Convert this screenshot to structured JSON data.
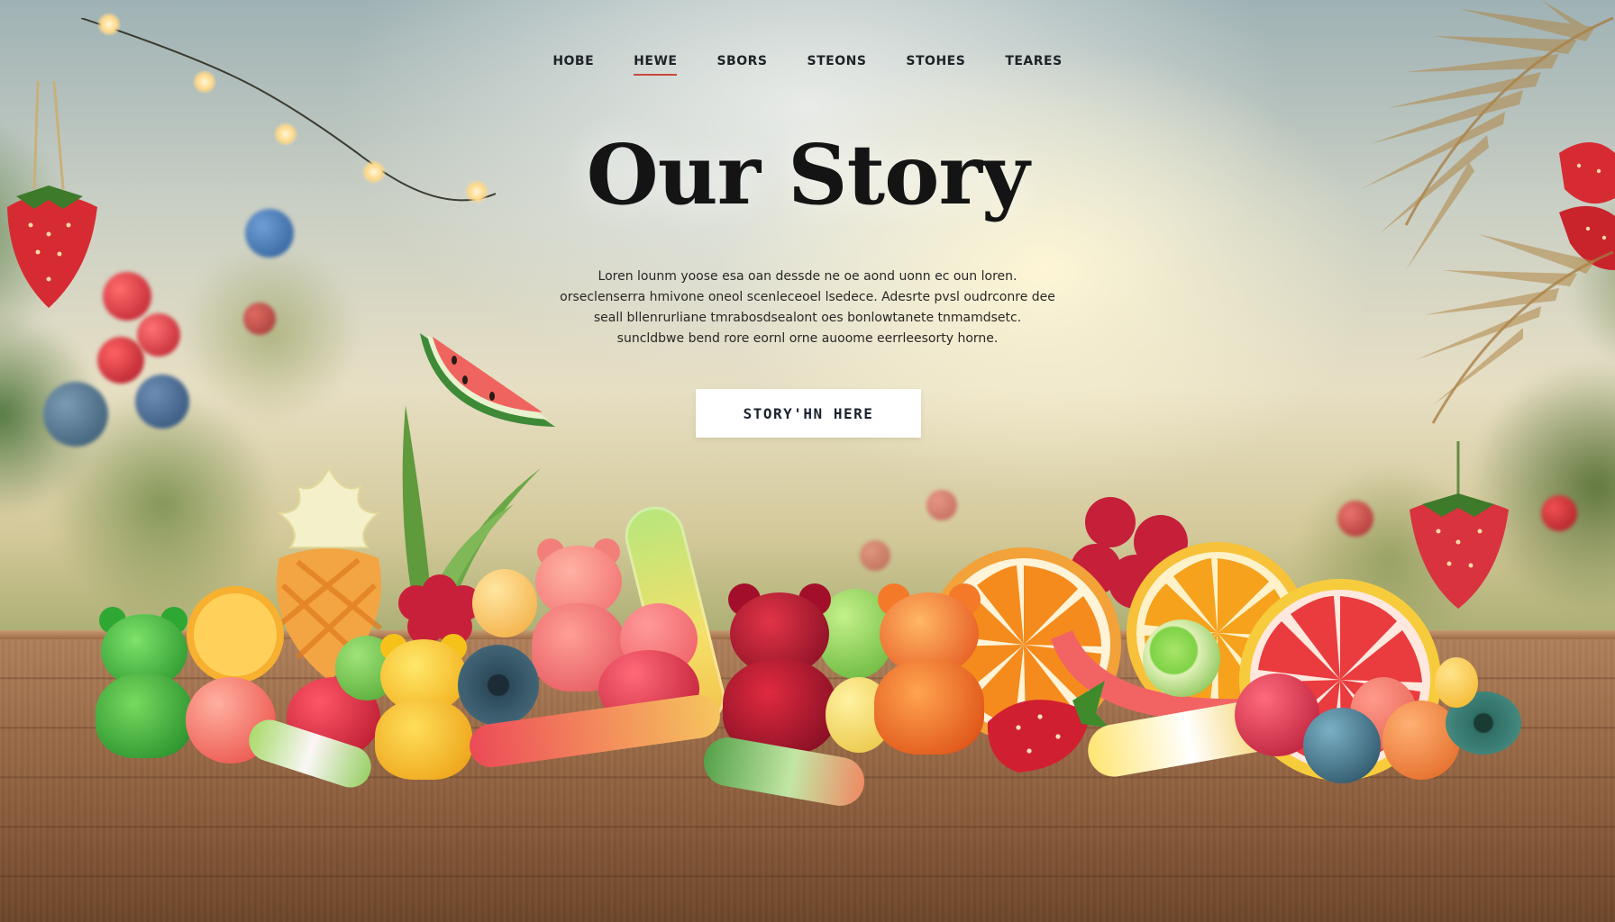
{
  "nav": {
    "items": [
      {
        "label": "HOBE",
        "active": false
      },
      {
        "label": "HEWE",
        "active": true
      },
      {
        "label": "SBORS",
        "active": false
      },
      {
        "label": "STEONS",
        "active": false
      },
      {
        "label": "STOHES",
        "active": false
      },
      {
        "label": "TEARES",
        "active": false
      }
    ],
    "active_color": "#c9473d"
  },
  "hero": {
    "title": "Our Story",
    "paragraph": "Loren lounm yoose esa oan dessde ne oe aond uonn ec oun loren. orseclenserra hmivone oneol scenleceoel lsedece. Adesrte pvsl oudrconre dee seall bllenrurliane tmrabosdsealont oes bonlowtanete tnmamdsetc. suncldbwe bend rore eornl orne auoome eerrleesorty horne.",
    "button_label": "STORY'HN HERE"
  },
  "colors": {
    "title": "#141414",
    "table_wood": "#9c6c48",
    "button_bg": "#ffffff"
  },
  "icons": [
    "strawberry-icon",
    "watermelon-slice-icon",
    "gummy-bear-icon",
    "citrus-slice-icon"
  ]
}
